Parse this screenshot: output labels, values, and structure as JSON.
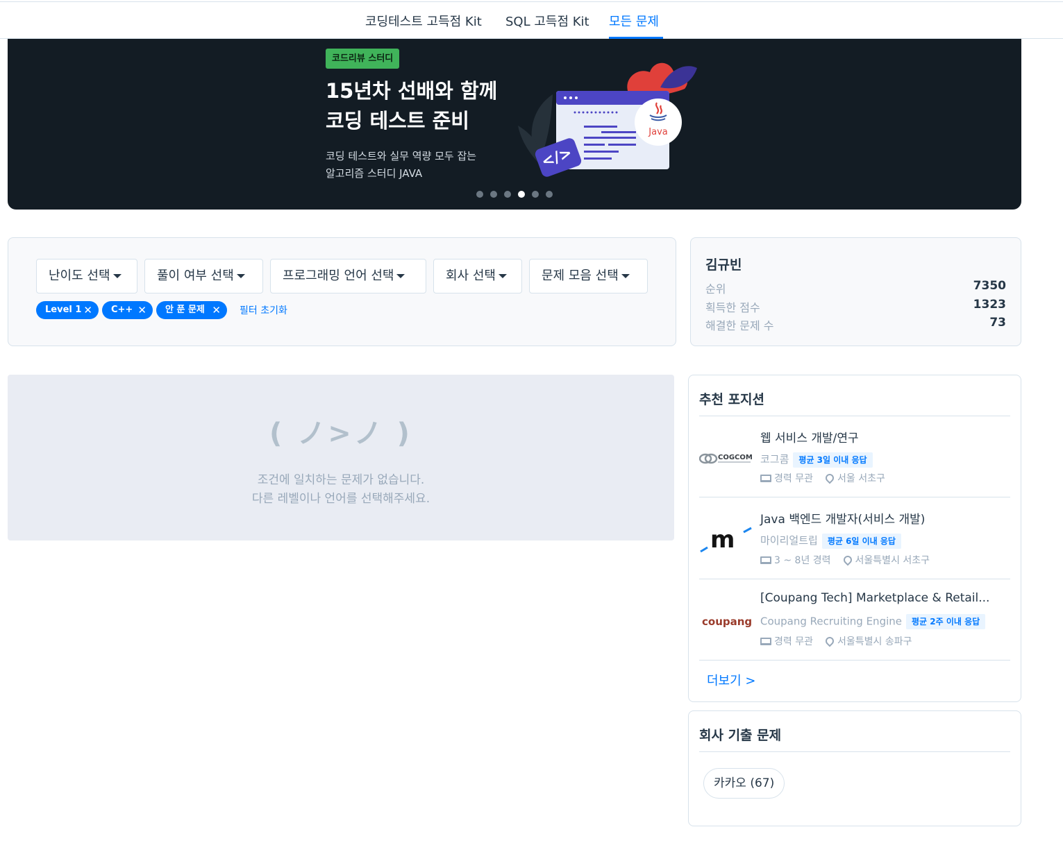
{
  "top_nav": {
    "tabs": [
      {
        "label": "코딩테스트 고득점 Kit",
        "active": false
      },
      {
        "label": "SQL 고득점 Kit",
        "active": false
      },
      {
        "label": "모든 문제",
        "active": true
      }
    ]
  },
  "banner": {
    "badge": "코드리뷰 스터디",
    "title": "15년차 선배와 함께\n코딩 테스트 준비",
    "subtitle": "코딩 테스트와 실무 역량 모두 잡는\n알고리즘 스터디 JAVA",
    "java_label": "Java",
    "code_label": "</>",
    "slide_count": 6,
    "active_slide": 4
  },
  "filters": {
    "dropdowns": [
      "난이도 선택",
      "풀이 여부 선택",
      "프로그래밍 언어 선택",
      "회사 선택",
      "문제 모음 선택"
    ],
    "chips": [
      "Level 1",
      "C++",
      "안 푼 문제"
    ],
    "chip_remove_glyph": "✕",
    "reset_label": "필터 초기화"
  },
  "user": {
    "name": "김규빈",
    "stats": [
      {
        "label": "순위",
        "value": "7350"
      },
      {
        "label": "획득한 점수",
        "value": "1323"
      },
      {
        "label": "해결한 문제 수",
        "value": "73"
      }
    ]
  },
  "empty_state": {
    "kaomoji": "( ノ>ノ )",
    "line1": "조건에 일치하는 문제가 없습니다.",
    "line2": "다른 레벨이나 언어를 선택해주세요."
  },
  "positions": {
    "title": "추천 포지션",
    "jobs": [
      {
        "title": "웹 서비스 개발/연구",
        "company": "코그콤",
        "badge": "평균 3일 이내 응답",
        "experience": "경력 무관",
        "location": "서울 서초구",
        "logo_text": "COGCOM"
      },
      {
        "title": "Java 백엔드 개발자(서비스 개발)",
        "company": "마이리얼트립",
        "badge": "평균 6일 이내 응답",
        "experience": "3 ~ 8년 경력",
        "location": "서울특별시 서초구",
        "logo_text": "m"
      },
      {
        "title": "[Coupang Tech] Marketplace & Retail...",
        "company": "Coupang Recruiting Engine",
        "badge": "평균 2주 이내 응답",
        "experience": "경력 무관",
        "location": "서울특별시 송파구",
        "logo_text": "coupang"
      }
    ],
    "more_label": "더보기 >"
  },
  "company_problems": {
    "title": "회사 기출 문제",
    "items": [
      "카카오 (67)"
    ]
  },
  "colors": {
    "accent": "#0078ff",
    "banner_bg": "#131c24",
    "badge_green": "#40b35a",
    "text_main": "#263747",
    "text_muted": "#98a8b9"
  }
}
